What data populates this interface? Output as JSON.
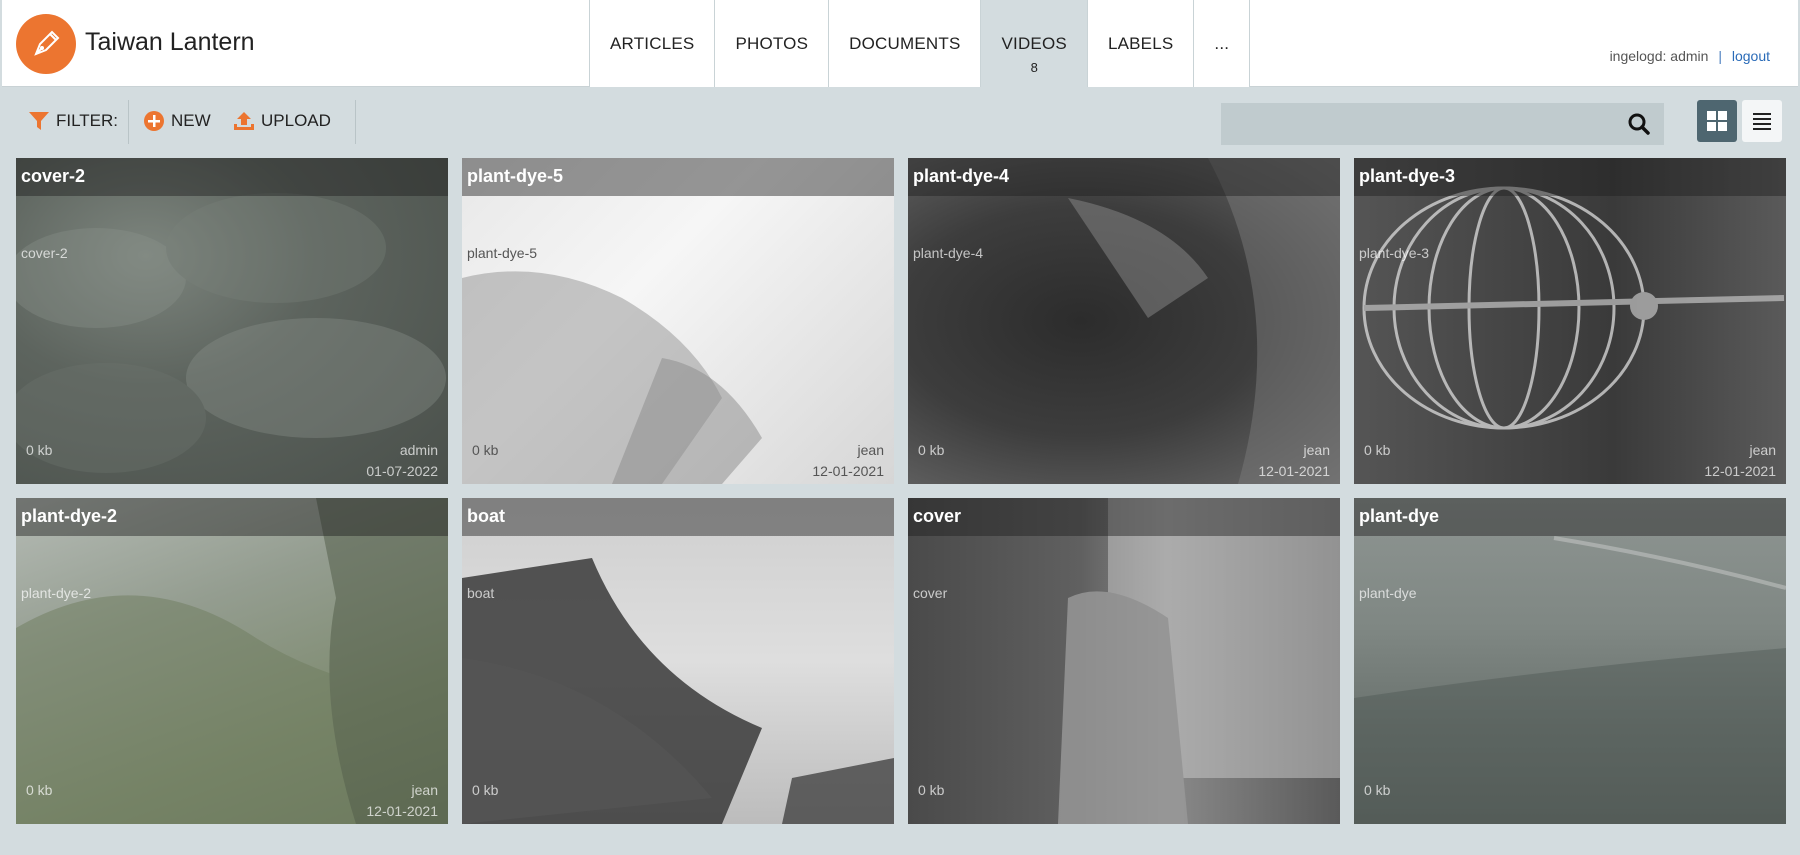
{
  "header": {
    "app_title": "Taiwan Lantern",
    "tabs": [
      {
        "label": "ARTICLES",
        "count": ""
      },
      {
        "label": "PHOTOS",
        "count": ""
      },
      {
        "label": "DOCUMENTS",
        "count": ""
      },
      {
        "label": "VIDEOS",
        "count": "8"
      },
      {
        "label": "LABELS",
        "count": ""
      },
      {
        "label": "...",
        "count": ""
      }
    ],
    "active_tab": "VIDEOS",
    "user_label": "ingelogd: admin",
    "separator": "|",
    "logout_label": "logout"
  },
  "toolbar": {
    "filter_label": "FILTER:",
    "new_label": "NEW",
    "upload_label": "UPLOAD",
    "search_value": "",
    "view_modes": [
      "grid",
      "list"
    ],
    "active_view": "grid"
  },
  "videos": [
    {
      "title": "cover-2",
      "name": "cover-2",
      "size": "0 kb",
      "author": "admin",
      "date": "01-07-2022"
    },
    {
      "title": "plant-dye-5",
      "name": "plant-dye-5",
      "size": "0 kb",
      "author": "jean",
      "date": "12-01-2021"
    },
    {
      "title": "plant-dye-4",
      "name": "plant-dye-4",
      "size": "0 kb",
      "author": "jean",
      "date": "12-01-2021"
    },
    {
      "title": "plant-dye-3",
      "name": "plant-dye-3",
      "size": "0 kb",
      "author": "jean",
      "date": "12-01-2021"
    },
    {
      "title": "plant-dye-2",
      "name": "plant-dye-2",
      "size": "0 kb",
      "author": "jean",
      "date": "12-01-2021"
    },
    {
      "title": "boat",
      "name": "boat",
      "size": "0 kb",
      "author": "",
      "date": ""
    },
    {
      "title": "cover",
      "name": "cover",
      "size": "0 kb",
      "author": "",
      "date": ""
    },
    {
      "title": "plant-dye",
      "name": "plant-dye",
      "size": "0 kb",
      "author": "",
      "date": ""
    }
  ],
  "colors": {
    "brand": "#ec7530",
    "background": "#d3dcdf",
    "link": "#2a6bb8",
    "active_view": "#4e6670"
  }
}
